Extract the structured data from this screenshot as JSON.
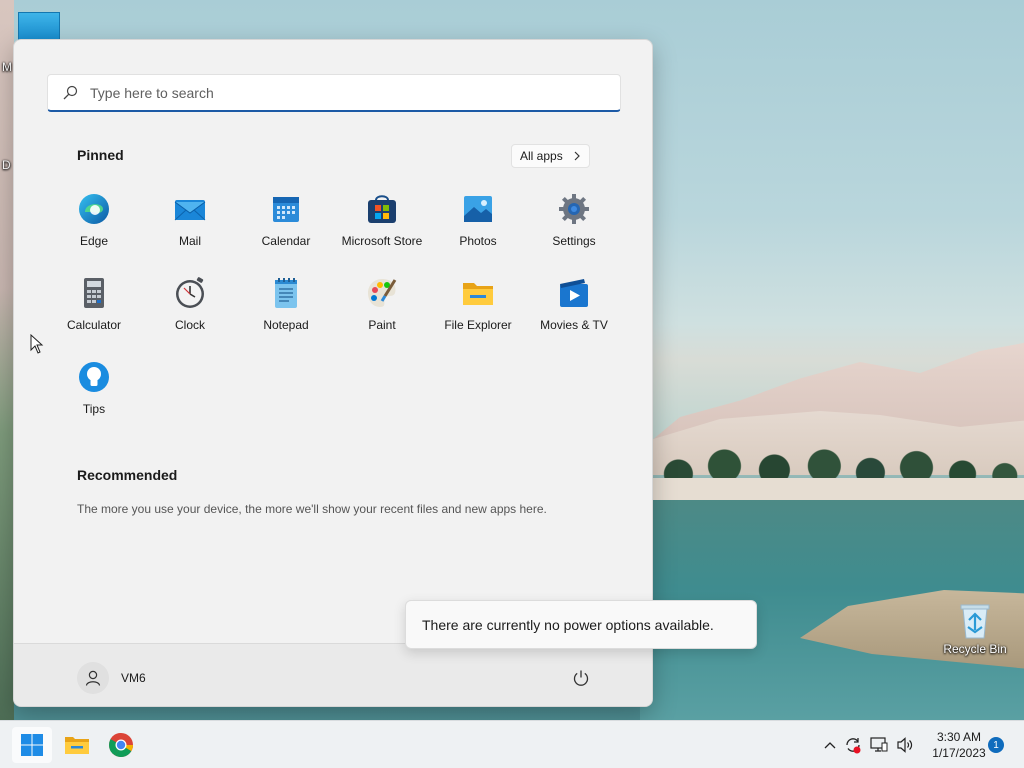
{
  "desktop": {
    "icons": [
      {
        "label": "M",
        "icon": "generic-icon"
      },
      {
        "label": "D",
        "icon": "generic-icon"
      },
      {
        "label": "Recycle Bin",
        "icon": "recycle-bin-icon"
      }
    ]
  },
  "start_menu": {
    "search": {
      "placeholder": "Type here to search",
      "value": ""
    },
    "pinned_title": "Pinned",
    "all_apps_label": "All apps",
    "pinned_apps": [
      {
        "label": "Edge",
        "icon": "edge-icon"
      },
      {
        "label": "Mail",
        "icon": "mail-icon"
      },
      {
        "label": "Calendar",
        "icon": "calendar-icon"
      },
      {
        "label": "Microsoft Store",
        "icon": "store-icon"
      },
      {
        "label": "Photos",
        "icon": "photos-icon"
      },
      {
        "label": "Settings",
        "icon": "gear-icon"
      },
      {
        "label": "Calculator",
        "icon": "calculator-icon"
      },
      {
        "label": "Clock",
        "icon": "clock-icon"
      },
      {
        "label": "Notepad",
        "icon": "notepad-icon"
      },
      {
        "label": "Paint",
        "icon": "paint-icon"
      },
      {
        "label": "File Explorer",
        "icon": "folder-icon"
      },
      {
        "label": "Movies & TV",
        "icon": "movies-icon"
      },
      {
        "label": "Tips",
        "icon": "tips-icon"
      }
    ],
    "recommended_title": "Recommended",
    "recommended_text": "The more you use your device, the more we'll show your recent files and new apps here.",
    "user_name": "VM6"
  },
  "tooltip": {
    "text": "There are currently no power options available."
  },
  "taskbar": {
    "apps": [
      {
        "name": "start",
        "icon": "windows-icon"
      },
      {
        "name": "file-explorer",
        "icon": "folder-icon"
      },
      {
        "name": "chrome",
        "icon": "chrome-icon"
      }
    ],
    "tray_icons": [
      "chevron-up-icon",
      "sync-icon",
      "network-icon",
      "volume-icon"
    ],
    "time": "3:30 AM",
    "date": "1/17/2023",
    "notification_count": "1"
  },
  "colors": {
    "accent": "#1c5aa6",
    "notification_badge": "#0f6cbd"
  }
}
